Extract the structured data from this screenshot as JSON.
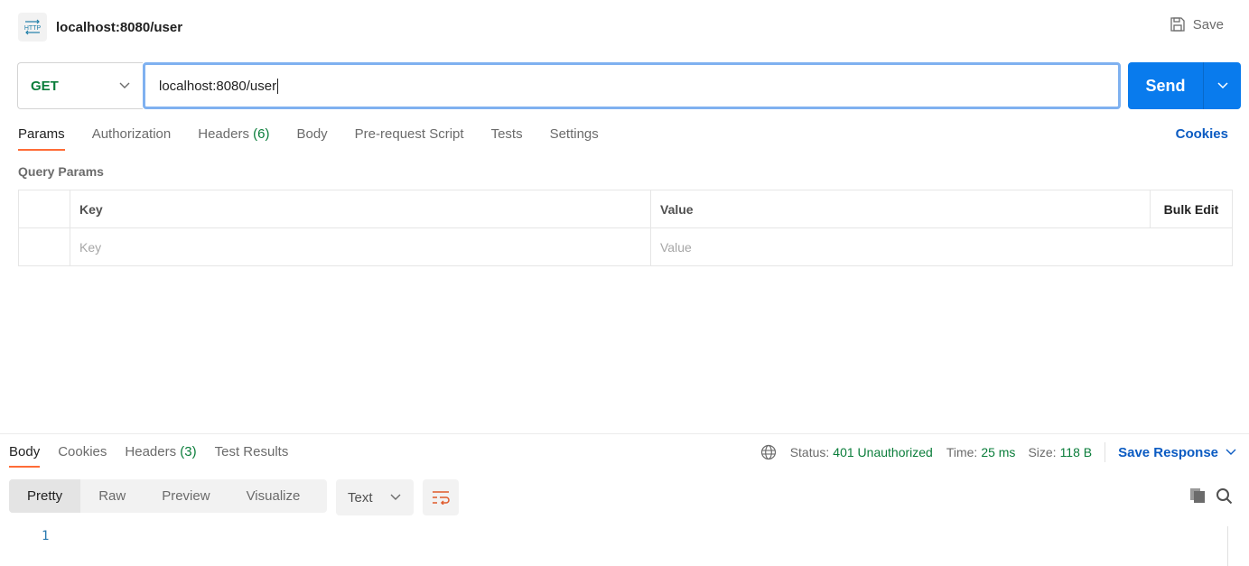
{
  "header": {
    "icon": "http-icon",
    "title": "localhost:8080/user",
    "save_label": "Save"
  },
  "request": {
    "method": "GET",
    "url": "localhost:8080/user",
    "send_label": "Send"
  },
  "request_tabs": [
    {
      "label": "Params",
      "active": true
    },
    {
      "label": "Authorization"
    },
    {
      "label": "Headers",
      "count": "(6)"
    },
    {
      "label": "Body"
    },
    {
      "label": "Pre-request Script"
    },
    {
      "label": "Tests"
    },
    {
      "label": "Settings"
    }
  ],
  "cookies_link": "Cookies",
  "query_params": {
    "label": "Query Params",
    "columns": {
      "key": "Key",
      "value": "Value",
      "bulk_edit": "Bulk Edit"
    },
    "placeholders": {
      "key": "Key",
      "value": "Value"
    }
  },
  "response": {
    "tabs": [
      {
        "label": "Body",
        "active": true
      },
      {
        "label": "Cookies"
      },
      {
        "label": "Headers",
        "count": "(3)"
      },
      {
        "label": "Test Results"
      }
    ],
    "status_label": "Status:",
    "status_value": "401 Unauthorized",
    "time_label": "Time:",
    "time_value": "25 ms",
    "size_label": "Size:",
    "size_value": "118 B",
    "save_response_label": "Save Response",
    "view_modes": [
      "Pretty",
      "Raw",
      "Preview",
      "Visualize"
    ],
    "active_view": "Pretty",
    "format": "Text",
    "line_numbers": [
      "1"
    ]
  },
  "colors": {
    "accent_orange": "#ff6c37",
    "send_blue": "#097bed",
    "link_blue": "#0b5bc2",
    "success_green": "#0a7d3a"
  }
}
